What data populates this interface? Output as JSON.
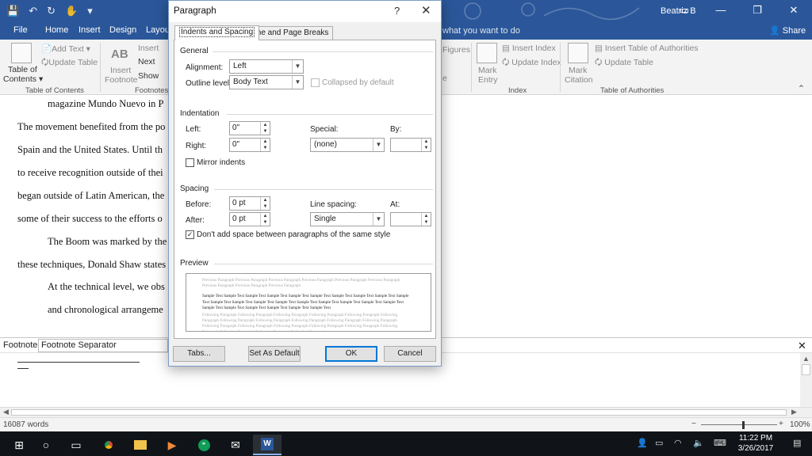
{
  "word": {
    "user": "Beatriz B",
    "tabs": [
      "File",
      "Home",
      "Insert",
      "Design",
      "Layout"
    ],
    "tell_me": "what you want to do",
    "share": "Share",
    "window_controls": [
      "—",
      "❐",
      "✕"
    ],
    "ribbon": {
      "toc": {
        "line1": "Table of",
        "line2": "Contents ▾",
        "group": "Table of Contents",
        "add_text": "Add Text ▾",
        "update_table": "Update Table"
      },
      "footnotes": {
        "insert_footnote_1": "Insert",
        "insert_footnote_2": "Footnote",
        "ab1": "AB",
        "insert": "Insert",
        "next": "Next",
        "show": "Show",
        "group": "Footnotes"
      },
      "captions": {
        "figures": "Figures",
        "e": "e"
      },
      "index": {
        "mark_entry_1": "Mark",
        "mark_entry_2": "Entry",
        "insert_index": "Insert Index",
        "update_index": "Update Index",
        "group": "Index"
      },
      "toa": {
        "mark_citation_1": "Mark",
        "mark_citation_2": "Citation",
        "insert_toa": "Insert Table of Authorities",
        "update_table": "Update Table",
        "group": "Table of Authorities"
      }
    },
    "document_lines": [
      "magazine Mundo Nuevo in P",
      "The movement benefited from the po",
      "Spain and the United States. Until th",
      "to receive recognition outside of thei",
      "began outside of Latin American, the",
      "some of their success to the efforts o",
      "The Boom was marked by the",
      "these techniques, Donald Shaw states",
      "At the technical level, we obs",
      "and chronological arrangeme"
    ],
    "footnotes_label": "Footnotes",
    "footnote_select": "Footnote Separator",
    "status": {
      "words": "16087 words",
      "zoom": "100%",
      "minus": "−",
      "plus": "+"
    },
    "taskbar": {
      "time": "11:22 PM",
      "date": "3/26/2017"
    }
  },
  "dialog": {
    "title": "Paragraph",
    "help": "?",
    "close": "✕",
    "tabs": [
      "Indents and Spacing",
      "Line and Page Breaks"
    ],
    "general": {
      "heading": "General",
      "alignment_label": "Alignment:",
      "alignment_value": "Left",
      "outline_label": "Outline level:",
      "outline_value": "Body Text",
      "collapsed_label": "Collapsed by default"
    },
    "indentation": {
      "heading": "Indentation",
      "left_label": "Left:",
      "left_value": "0\"",
      "right_label": "Right:",
      "right_value": "0\"",
      "special_label": "Special:",
      "special_value": "(none)",
      "by_label": "By:",
      "by_value": "",
      "mirror_label": "Mirror indents"
    },
    "spacing": {
      "heading": "Spacing",
      "before_label": "Before:",
      "before_value": "0 pt",
      "after_label": "After:",
      "after_value": "0 pt",
      "line_spacing_label": "Line spacing:",
      "line_spacing_value": "Single",
      "at_label": "At:",
      "at_value": "",
      "dont_add_label": "Don't add space between paragraphs of the same style",
      "dont_add_checked": true
    },
    "preview": {
      "heading": "Preview",
      "previous": "Previous Paragraph Previous Paragraph Previous Paragraph Previous Paragraph Previous Paragraph Previous Paragraph Previous Paragraph Previous Paragraph Previous Paragraph",
      "sample": "Sample Text Sample Text Sample Text Sample Text Sample Text Sample Text Sample Text Sample Text Sample Text Sample Text Sample Text Sample Text Sample Text Sample Text Sample Text Sample Text Sample Text Sample Text Sample Text Sample Text Sample Text Sample Text Sample Text Sample Text Sample Text",
      "following": "Following Paragraph Following Paragraph Following Paragraph Following Paragraph Following Paragraph Following Paragraph Following Paragraph Following Paragraph Following Paragraph Following Paragraph Following Paragraph Following Paragraph Following Paragraph Following Paragraph Following Paragraph Following Paragraph Following Paragraph Following Paragraph Following Paragraph Following Paragraph"
    },
    "buttons": {
      "tabs": "Tabs...",
      "default": "Set As Default",
      "ok": "OK",
      "cancel": "Cancel"
    }
  }
}
